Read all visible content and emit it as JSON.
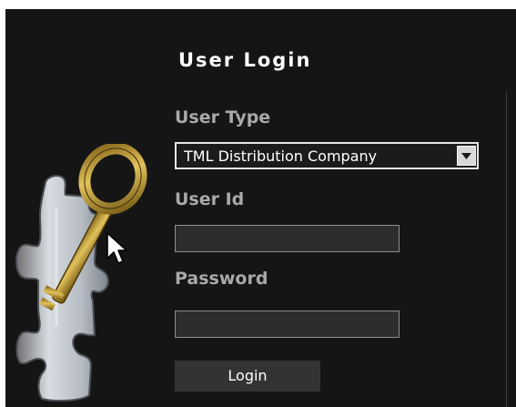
{
  "login": {
    "title": "User Login",
    "user_type_label": "User Type",
    "user_type_selected": "TML Distribution Company",
    "user_id_label": "User Id",
    "user_id_value": "",
    "password_label": "Password",
    "password_value": "",
    "login_button": "Login"
  },
  "icons": {
    "illustration": "puzzle-piece-with-golden-key",
    "dropdown": "dropdown-arrow-icon",
    "cursor": "mouse-pointer-icon"
  },
  "colors": {
    "panel_background": "#151515",
    "label_text": "#a9a9a9",
    "title_text": "#ffffff",
    "input_background": "#2d2d2d",
    "button_background": "#333333",
    "key_gold": "#c9a232"
  }
}
